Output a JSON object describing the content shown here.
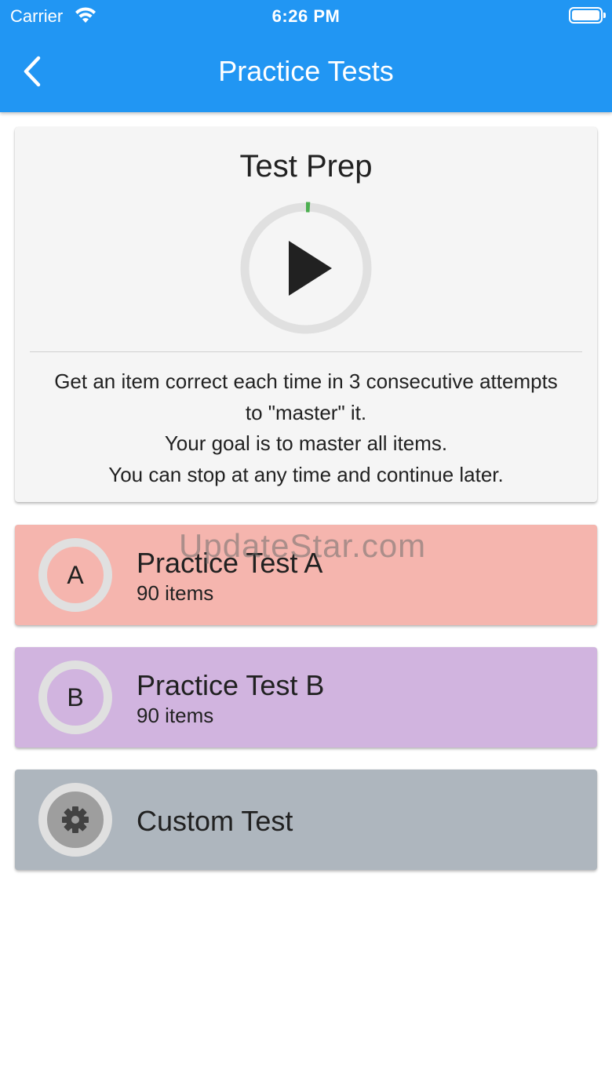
{
  "status_bar": {
    "carrier": "Carrier",
    "time": "6:26 PM",
    "icons": [
      "wifi-icon",
      "battery-icon"
    ]
  },
  "header": {
    "back_icon": "chevron-left-icon",
    "title": "Practice Tests",
    "color": "#2196F3"
  },
  "test_prep": {
    "title": "Test Prep",
    "progress": 0.02,
    "progress_color": "#4CAF50",
    "play_icon": "play-icon",
    "description": [
      "Get an item correct each time in 3 consecutive attempts",
      "to \"master\" it.",
      "Your goal is to master all items.",
      "You can stop at any time and continue later."
    ]
  },
  "tests": [
    {
      "letter": "A",
      "title": "Practice Test A",
      "subtitle": "90 items",
      "color": "#F5B5AE"
    },
    {
      "letter": "B",
      "title": "Practice Test B",
      "subtitle": "90 items",
      "color": "#D1B4DF"
    },
    {
      "icon": "gear-icon",
      "title": "Custom Test",
      "color": "#AEB6BE"
    }
  ],
  "watermark": "UpdateStar.com"
}
